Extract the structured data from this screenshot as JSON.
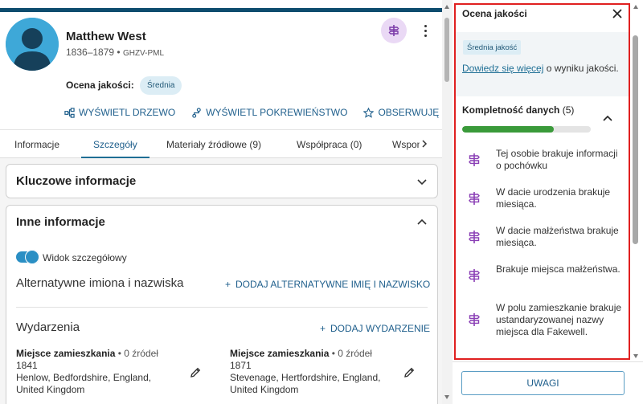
{
  "person": {
    "name": "Matthew West",
    "lifespan": "1836–1879",
    "separator": " • ",
    "pid": "GHZV-PML",
    "quality_label": "Ocena jakości:",
    "quality_value": "Średnia"
  },
  "actions": [
    {
      "label": "WYŚWIETL DRZEWO",
      "icon": "tree-icon"
    },
    {
      "label": "WYŚWIETL POKREWIEŃSTWO",
      "icon": "relationship-icon"
    },
    {
      "label": "OBSERWUJĘ",
      "icon": "star-icon"
    }
  ],
  "tabs": [
    {
      "label": "Informacje",
      "active": false
    },
    {
      "label": "Szczegóły",
      "active": true
    },
    {
      "label": "Materiały źródłowe (9)",
      "active": false
    },
    {
      "label": "Współpraca (0)",
      "active": false
    },
    {
      "label": "Wspomnienia",
      "active": false
    }
  ],
  "cards": {
    "key_info_title": "Kluczowe informacje",
    "other_info_title": "Inne informacje",
    "detail_view_label": "Widok szczegółowy",
    "alt_names_title": "Alternatywne imiona i nazwiska",
    "add_alt_name": "DODAJ ALTERNATYWNE IMIĘ I NAZWISKO",
    "events_title": "Wydarzenia",
    "add_event": "DODAJ WYDARZENIE",
    "plus": "+"
  },
  "events": [
    {
      "type": "Miejsce zamieszkania",
      "sources": " • 0 źródeł",
      "year": "1841",
      "place_line1": "Henlow, Bedfordshire, England,",
      "place_line2": "United Kingdom"
    },
    {
      "type": "Miejsce zamieszkania",
      "sources": " • 0 źródeł",
      "year": "1871",
      "place_line1": "Stevenage, Hertfordshire, England,",
      "place_line2": "United Kingdom"
    }
  ],
  "panel": {
    "title": "Ocena jakości",
    "badge": "Średnia jakość",
    "learn_more_link": "Dowiedz się więcej",
    "learn_more_rest": " o wyniku jakości.",
    "section_title": "Kompletność danych",
    "section_count": " (5)",
    "completeness_fraction": 0.71,
    "issues": [
      "Tej osobie brakuje informacji o pochówku",
      "W dacie urodzenia brakuje miesiąca.",
      "W dacie małżeństwa brakuje miesiąca.",
      "Brakuje miejsca małżeństwa.",
      "W polu zamieszkanie brakuje ustandaryzowanej nazwy miejsca dla Fakewell."
    ],
    "footer_button": "UWAGI"
  },
  "colors": {
    "accent": "#1f5f8c",
    "highlight": "#e02020",
    "progress": "#3a9a3a",
    "issue_icon": "#8a3fb5"
  }
}
